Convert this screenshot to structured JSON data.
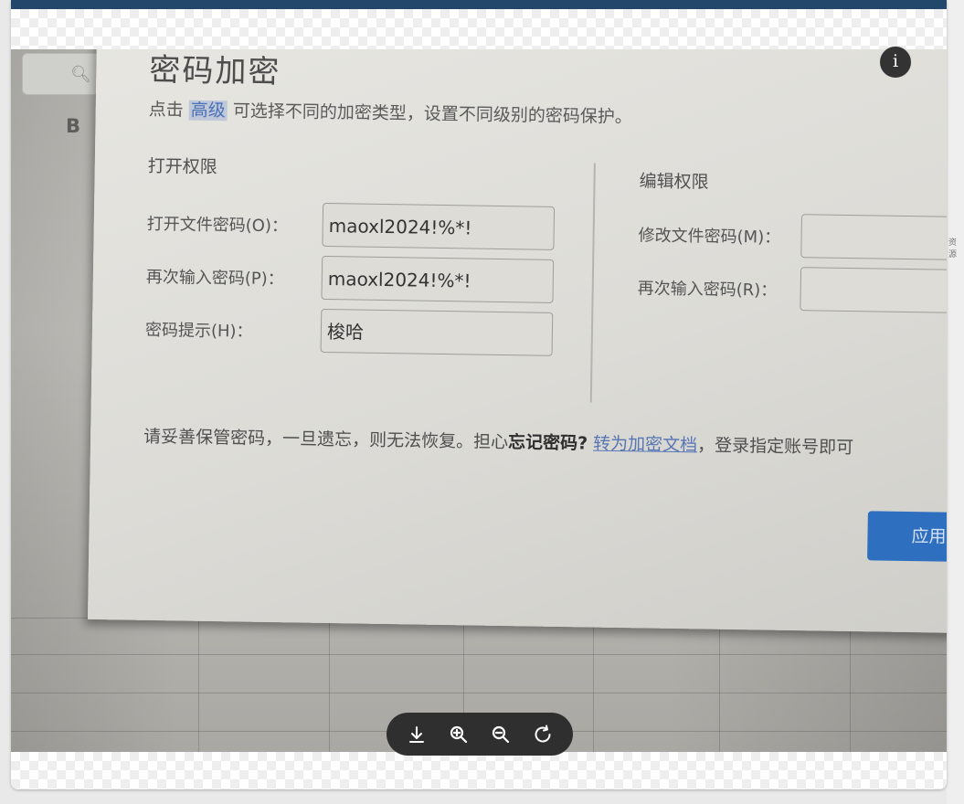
{
  "dialog": {
    "title": "密码加密",
    "instruction_prefix": "点击",
    "instruction_link": "高级",
    "instruction_suffix": "可选择不同的加密类型，设置不同级别的密码保护。",
    "open_section": {
      "title": "打开权限",
      "open_password_label": "打开文件密码(O)：",
      "open_password_value": "maoxl2024!%*!",
      "confirm_password_label": "再次输入密码(P)：",
      "confirm_password_value": "maoxl2024!%*!",
      "hint_label": "密码提示(H)：",
      "hint_value": "梭哈"
    },
    "edit_section": {
      "title": "编辑权限",
      "modify_password_label": "修改文件密码(M)：",
      "modify_password_value": "",
      "confirm_modify_label": "再次输入密码(R)：",
      "confirm_modify_value": ""
    },
    "warning": {
      "text": "请妥善保管密码，一旦遗忘，则无法恢复。担心",
      "bold": "忘记密码?",
      "link": "转为加密文档",
      "suffix": "，登录指定账号即可"
    },
    "apply_label": "应用"
  },
  "background": {
    "column_letter": "B"
  },
  "side_text": "资源",
  "viewer": {
    "info_icon": "info-icon",
    "toolbar_icons": [
      "download-icon",
      "zoom-in-icon",
      "zoom-out-icon",
      "rotate-icon"
    ]
  },
  "colors": {
    "topbar": "#23466b",
    "apply_button": "#2f6fc0",
    "toolbar": "#2f2f2f"
  }
}
